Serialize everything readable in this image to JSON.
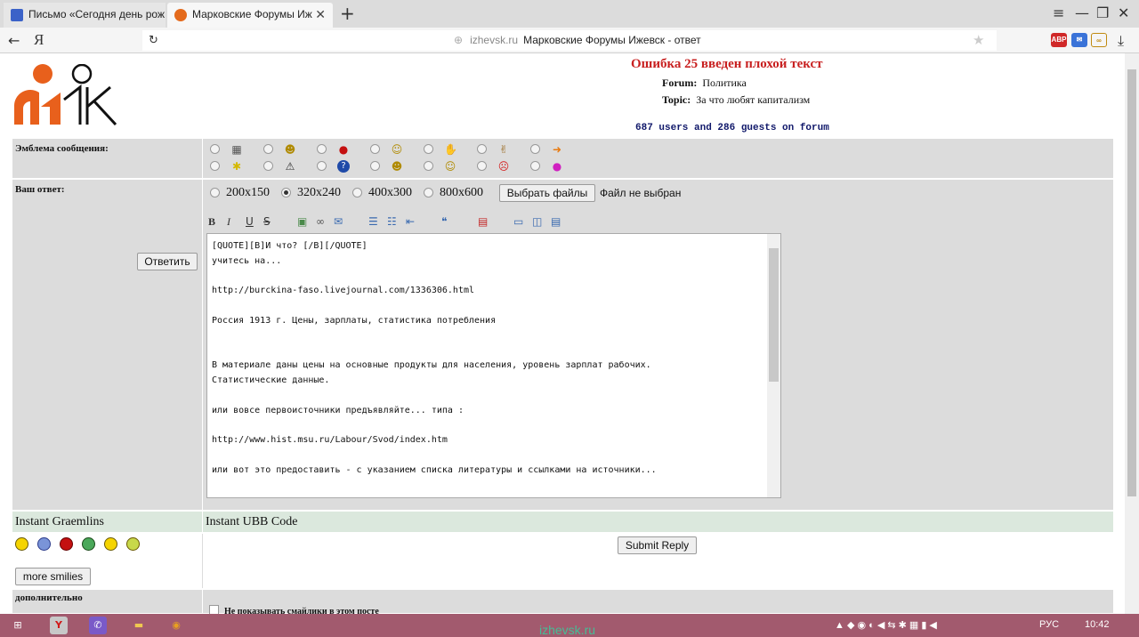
{
  "browser": {
    "tabs": [
      {
        "title": "Письмо «Сегодня день рож"
      },
      {
        "title": "Марковские Форумы Иж",
        "close": "✕"
      }
    ],
    "new_tab": "+",
    "back": "←",
    "yandex": "Я",
    "reload": "↻",
    "url_domain": "izhevsk.ru",
    "url_title": "Марковские Форумы Ижевск - ответ",
    "star": "★",
    "download": "⤓",
    "win_controls": [
      "≡",
      "—",
      "❐",
      "✕"
    ]
  },
  "header": {
    "error": "Ошибка 25 введен плохой текст",
    "forum_label": "Forum:",
    "forum_value": "Политика",
    "topic_label": "Topic:",
    "topic_value": "За что любят капитализм",
    "online": "687 users and 286 guests on forum"
  },
  "form": {
    "emblem_label": "Эмблема сообщения:",
    "emblems_row1": [
      "calculator-icon",
      "grin-icon",
      "red-dot-icon",
      "smile-icon",
      "thumbs-down-icon",
      "thumbs-up-icon",
      "arrow-right-icon"
    ],
    "emblems_row2": [
      "lightbulb-icon",
      "warning-icon",
      "question-icon",
      "cool-icon",
      "happy-icon",
      "angry-icon",
      "magenta-dot-icon"
    ],
    "reply_label": "Ваш ответ:",
    "reply_button": "Ответить",
    "image_sizes": [
      "200x150",
      "320x240",
      "400x300",
      "800x600"
    ],
    "selected_size": "320x240",
    "file_button": "Выбрать файлы",
    "file_status": "Файл не выбран",
    "toolbar": {
      "bold": "B",
      "italic": "I",
      "underline": "U",
      "strike": "S"
    },
    "message": "[QUOTE][B]И что? [/B][/QUOTE]\nучитесь на...\n\nhttp://burckina-faso.livejournal.com/1336306.html\n\nРоссия 1913 г. Цены, зарплаты, статистика потребления\n\n\nВ материале даны цены на основные продукты для населения, уровень зарплат рабочих.\nСтатистические данные.\n\nили вовсе первоисточники предъявляйте... типа :\n\nhttp://www.hist.msu.ru/Labour/Svod/index.htm\n\nили вот это предоставить - с указанием списка литературы и ссылками на источники..."
  },
  "instant": {
    "graemlins_label": "Instant Graemlins",
    "ubb_label": "Instant UBB Code",
    "more_smilies": "more smilies",
    "submit": "Submit Reply",
    "extra_label": "дополнительно",
    "no_smilies_option": "Не показывать смайлики в этом посте"
  },
  "taskbar": {
    "lang": "РУС",
    "time": "10:42",
    "watermark": "izhevsk.ru"
  }
}
